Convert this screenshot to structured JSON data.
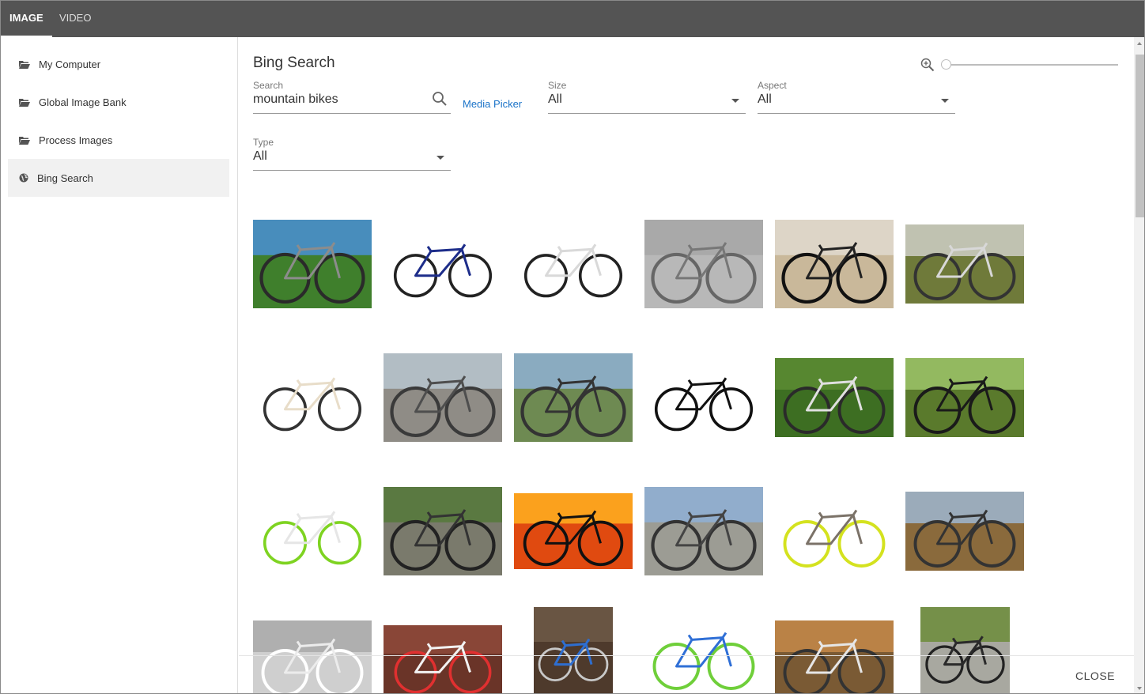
{
  "tabs": [
    {
      "label": "IMAGE",
      "active": true
    },
    {
      "label": "VIDEO",
      "active": false
    }
  ],
  "sidebar": {
    "items": [
      {
        "label": "My Computer",
        "icon": "folder-open-icon"
      },
      {
        "label": "Global Image Bank",
        "icon": "folder-open-icon"
      },
      {
        "label": "Process Images",
        "icon": "folder-open-icon"
      },
      {
        "label": "Bing Search",
        "icon": "globe-icon",
        "active": true
      }
    ]
  },
  "main": {
    "title": "Bing Search",
    "zoom_icon": "zoom-in-icon",
    "zoom_level": 0,
    "search": {
      "label": "Search",
      "value": "mountain bikes",
      "icon": "search-icon"
    },
    "media_picker": "Media Picker",
    "size": {
      "label": "Size",
      "value": "All"
    },
    "aspect": {
      "label": "Aspect",
      "value": "All"
    },
    "type": {
      "label": "Type",
      "value": "All"
    }
  },
  "footer": {
    "close_label": "CLOSE"
  },
  "colors": {
    "topbar": "#545454",
    "link": "#1a73c8",
    "active_item": "#f1f1f1"
  },
  "results": [
    {
      "kind": "photo",
      "bg": "#3f7f2c",
      "sky": "#4a8fd6",
      "frame": "#8c8c8c",
      "wheel": "#2a2a2a"
    },
    {
      "kind": "cutout",
      "bg": "#ffffff",
      "frame": "#1d2d8a",
      "wheel": "#222222"
    },
    {
      "kind": "cutout",
      "bg": "#ffffff",
      "frame": "#d9d9d9",
      "wheel": "#222222"
    },
    {
      "kind": "photo",
      "bg": "#b8b8b8",
      "sky": "#a6a6a6",
      "frame": "#777777",
      "wheel": "#666666"
    },
    {
      "kind": "photo",
      "bg": "#c9b89a",
      "sky": "#e0d9cf",
      "frame": "#222222",
      "wheel": "#111111"
    },
    {
      "kind": "photo",
      "bg": "#6f7a3a",
      "sky": "#cfcfc7",
      "frame": "#d8d8d8",
      "wheel": "#333333"
    },
    {
      "kind": "cutout",
      "bg": "#ffffff",
      "frame": "#e8ddc9",
      "wheel": "#333333"
    },
    {
      "kind": "photo",
      "bg": "#8f8c86",
      "sky": "#b9c6cf",
      "frame": "#4e4e4e",
      "wheel": "#3a3a3a"
    },
    {
      "kind": "photo",
      "bg": "#6e8a52",
      "sky": "#8fb0d4",
      "frame": "#333333",
      "wheel": "#333333"
    },
    {
      "kind": "cutout",
      "bg": "#ffffff",
      "frame": "#111111",
      "wheel": "#111111"
    },
    {
      "kind": "photo",
      "bg": "#3d6e22",
      "sky": "#5c8c33",
      "frame": "#e0e0e0",
      "wheel": "#2a2a2a"
    },
    {
      "kind": "photo",
      "bg": "#5a7a2c",
      "sky": "#9ec46a",
      "frame": "#1a1a1a",
      "wheel": "#1a1a1a"
    },
    {
      "kind": "cutout",
      "bg": "#ffffff",
      "frame": "#e6e6e6",
      "wheel": "#7ed321"
    },
    {
      "kind": "photo",
      "bg": "#7a7a6c",
      "sky": "#55793a",
      "frame": "#333333",
      "wheel": "#222222"
    },
    {
      "kind": "photo",
      "bg": "#e04a10",
      "sky": "#ffb020",
      "frame": "#111111",
      "wheel": "#111111"
    },
    {
      "kind": "photo",
      "bg": "#9c9c94",
      "sky": "#8fb0d6",
      "frame": "#444444",
      "wheel": "#333333"
    },
    {
      "kind": "cutout",
      "bg": "#ffffff",
      "frame": "#7b7268",
      "wheel": "#d4e21f"
    },
    {
      "kind": "photo",
      "bg": "#8a6a3c",
      "sky": "#9db6d0",
      "frame": "#333333",
      "wheel": "#333333"
    },
    {
      "kind": "photo",
      "bg": "#cfcfcf",
      "sky": "#a9a9a9",
      "frame": "#ececec",
      "wheel": "#ffffff"
    },
    {
      "kind": "photo",
      "bg": "#6a3428",
      "sky": "#8e4a3a",
      "frame": "#f2f2f2",
      "wheel": "#e03030"
    },
    {
      "kind": "photo",
      "bg": "#4e3a2c",
      "sky": "#6e5a48",
      "frame": "#2e6ed0",
      "wheel": "#c8c8c8"
    },
    {
      "kind": "cutout",
      "bg": "#ffffff",
      "frame": "#2f6fd6",
      "wheel": "#6fcf3a"
    },
    {
      "kind": "photo",
      "bg": "#7a5a34",
      "sky": "#c68a4a",
      "frame": "#e6e6e6",
      "wheel": "#333333"
    },
    {
      "kind": "photo",
      "bg": "#a8a8a0",
      "sky": "#6c8c3a",
      "frame": "#2a2a2a",
      "wheel": "#222222"
    }
  ]
}
